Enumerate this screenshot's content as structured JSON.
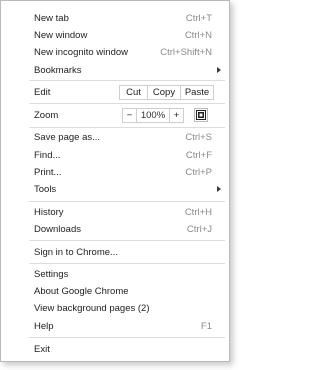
{
  "menu": {
    "new_tab": {
      "label": "New tab",
      "shortcut": "Ctrl+T"
    },
    "new_window": {
      "label": "New window",
      "shortcut": "Ctrl+N"
    },
    "new_incognito": {
      "label": "New incognito window",
      "shortcut": "Ctrl+Shift+N"
    },
    "bookmarks": {
      "label": "Bookmarks"
    },
    "edit": {
      "label": "Edit",
      "cut": "Cut",
      "copy": "Copy",
      "paste": "Paste"
    },
    "zoom": {
      "label": "Zoom",
      "minus": "−",
      "level": "100%",
      "plus": "+"
    },
    "save_page": {
      "label": "Save page as...",
      "shortcut": "Ctrl+S"
    },
    "find": {
      "label": "Find...",
      "shortcut": "Ctrl+F"
    },
    "print": {
      "label": "Print...",
      "shortcut": "Ctrl+P"
    },
    "tools": {
      "label": "Tools"
    },
    "history": {
      "label": "History",
      "shortcut": "Ctrl+H"
    },
    "downloads": {
      "label": "Downloads",
      "shortcut": "Ctrl+J"
    },
    "sign_in": {
      "label": "Sign in to Chrome..."
    },
    "settings": {
      "label": "Settings"
    },
    "about": {
      "label": "About Google Chrome"
    },
    "background_pages": {
      "label": "View background pages (2)"
    },
    "help": {
      "label": "Help",
      "shortcut": "F1"
    },
    "exit": {
      "label": "Exit"
    }
  },
  "icons": {
    "submenu": "submenu-arrow-icon",
    "fullscreen": "fullscreen-icon"
  }
}
